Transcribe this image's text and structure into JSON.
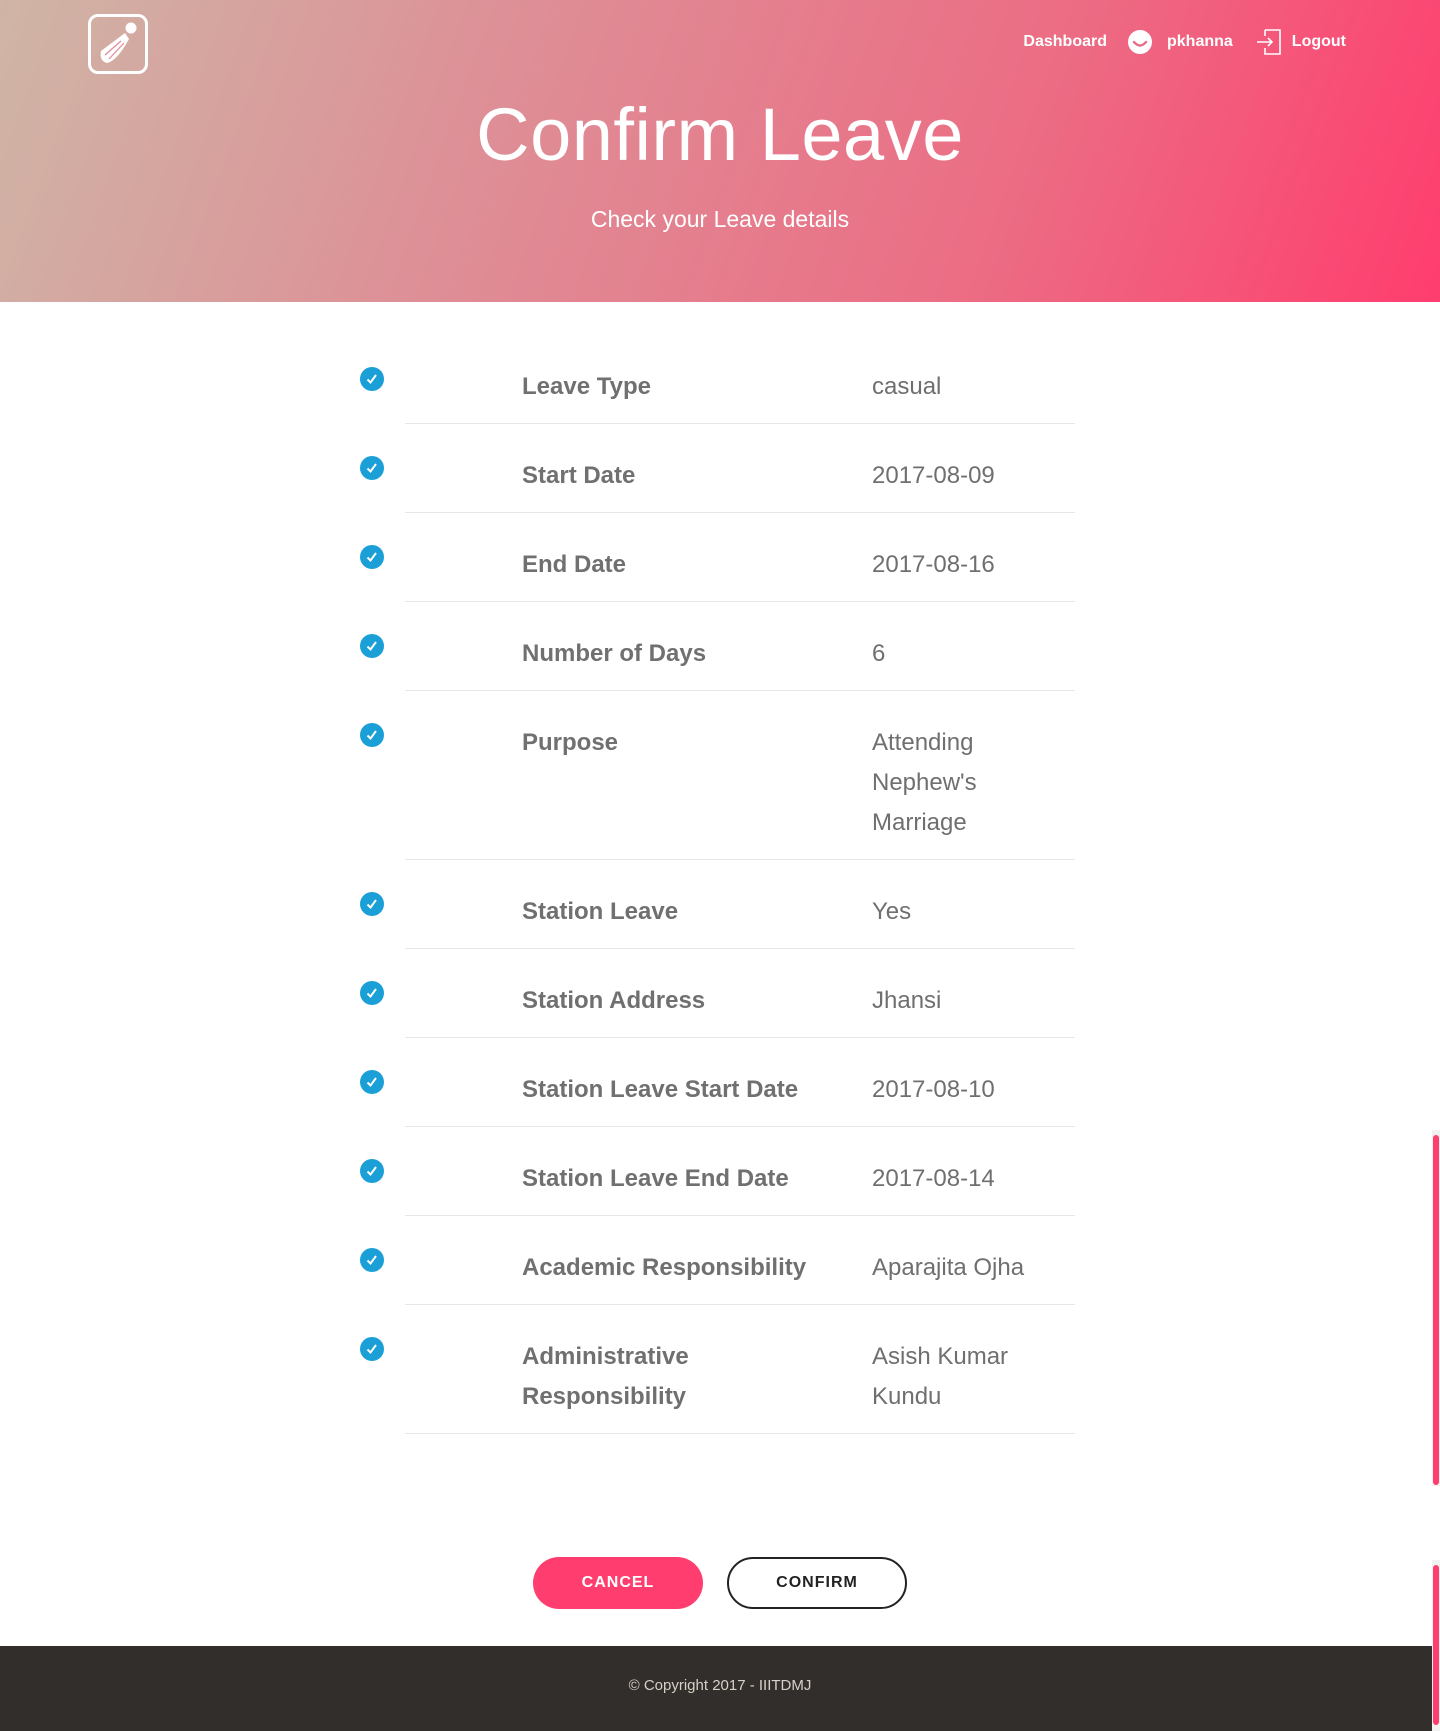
{
  "header": {
    "nav": {
      "dashboard": "Dashboard",
      "username": "pkhanna",
      "logout": "Logout"
    },
    "title": "Confirm Leave",
    "subtitle": "Check your Leave details"
  },
  "details": [
    {
      "label": "Leave Type",
      "value": "casual"
    },
    {
      "label": "Start Date",
      "value": "2017-08-09"
    },
    {
      "label": "End Date",
      "value": "2017-08-16"
    },
    {
      "label": "Number of Days",
      "value": "6"
    },
    {
      "label": "Purpose",
      "value": "Attending Nephew's Marriage"
    },
    {
      "label": "Station Leave",
      "value": "Yes"
    },
    {
      "label": "Station Address",
      "value": "Jhansi"
    },
    {
      "label": "Station Leave Start Date",
      "value": "2017-08-10"
    },
    {
      "label": "Station Leave End Date",
      "value": "2017-08-14"
    },
    {
      "label": "Academic Responsibility",
      "value": "Aparajita Ojha"
    },
    {
      "label": "Administrative Responsibility",
      "value": "Asish Kumar Kundu"
    }
  ],
  "actions": {
    "cancel": "CANCEL",
    "confirm": "CONFIRM"
  },
  "footer": {
    "copyright": "© Copyright 2017 - IIITDMJ"
  },
  "colors": {
    "accent": "#ff3d6e",
    "check": "#1a9fd6",
    "footer_bg": "#322e2b"
  },
  "icons": {
    "logo": "shuttlecock-icon",
    "user": "smiley-icon",
    "logout": "logout-icon",
    "row": "check-circle-icon"
  }
}
